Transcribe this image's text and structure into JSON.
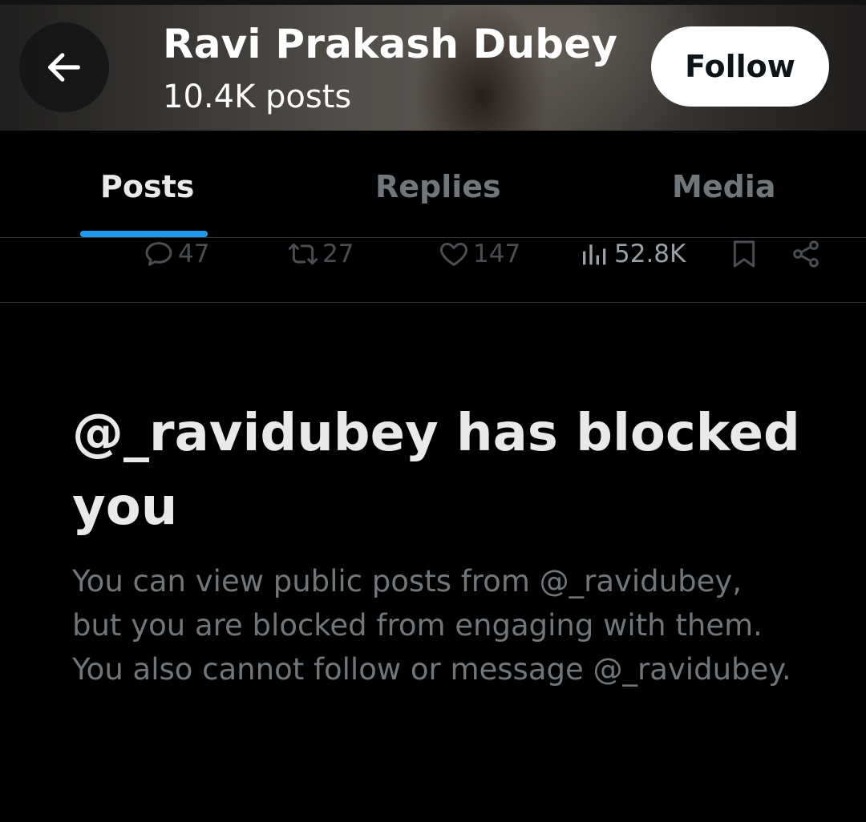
{
  "header": {
    "back_icon": "arrow-left-icon",
    "name": "Ravi Prakash Dubey",
    "post_count": "10.4K posts",
    "follow_label": "Follow"
  },
  "tabs": [
    {
      "label": "Posts",
      "active": true
    },
    {
      "label": "Replies",
      "active": false
    },
    {
      "label": "Media",
      "active": false
    }
  ],
  "post_actions": {
    "replies": "47",
    "reposts": "27",
    "likes": "147",
    "views": "52.8K",
    "icons": [
      "reply-icon",
      "repost-icon",
      "like-icon",
      "views-icon",
      "bookmark-icon",
      "share-icon"
    ]
  },
  "blocked": {
    "title": "@_ravidubey has blocked you",
    "message": "You can view public posts from @_ravidubey, but you are blocked from engaging with them. You also cannot follow or message @_ravidubey."
  },
  "colors": {
    "accent": "#1d9bf0",
    "background": "#000000",
    "muted_text": "#71767b",
    "primary_text": "#e7e9ea"
  }
}
